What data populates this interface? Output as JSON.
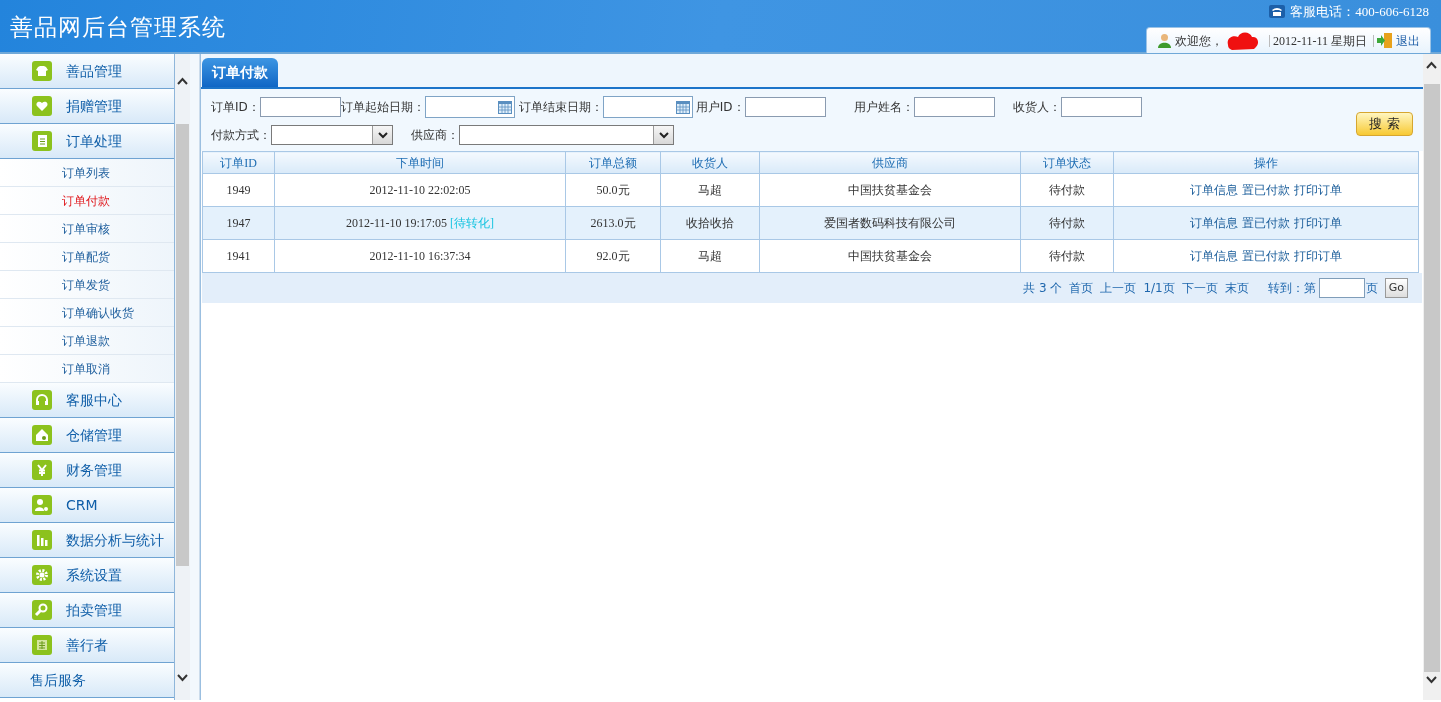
{
  "header": {
    "title": "善品网后台管理系统",
    "hotline": "客服电话：400-606-6128",
    "welcome": "欢迎您，",
    "date": "2012-11-11 星期日",
    "logout": "退出"
  },
  "sidebar": {
    "items": [
      {
        "label": "善品管理"
      },
      {
        "label": "捐赠管理"
      },
      {
        "label": "订单处理",
        "children": [
          {
            "label": "订单列表",
            "selected": false
          },
          {
            "label": "订单付款",
            "selected": true
          },
          {
            "label": "订单审核",
            "selected": false
          },
          {
            "label": "订单配货",
            "selected": false
          },
          {
            "label": "订单发货",
            "selected": false
          },
          {
            "label": "订单确认收货",
            "selected": false
          },
          {
            "label": "订单退款",
            "selected": false
          },
          {
            "label": "订单取消",
            "selected": false
          }
        ]
      },
      {
        "label": "客服中心"
      },
      {
        "label": "仓储管理"
      },
      {
        "label": "财务管理"
      },
      {
        "label": "CRM"
      },
      {
        "label": "数据分析与统计"
      },
      {
        "label": "系统设置"
      },
      {
        "label": "拍卖管理"
      },
      {
        "label": "善行者"
      },
      {
        "label": "售后服务"
      }
    ]
  },
  "panel": {
    "tab": "订单付款",
    "filters": [
      {
        "kind": "text",
        "label": "订单ID："
      },
      {
        "kind": "date",
        "label": "订单起始日期："
      },
      {
        "kind": "date",
        "label": "订单结束日期："
      },
      {
        "kind": "text",
        "label": "用户ID："
      },
      {
        "kind": "text",
        "label": "用户姓名："
      },
      {
        "kind": "text",
        "label": "收货人："
      },
      {
        "kind": "select",
        "label": "付款方式："
      },
      {
        "kind": "select",
        "label": "供应商："
      }
    ],
    "search_button": "搜 索",
    "table": {
      "columns": [
        "订单ID",
        "下单时间",
        "订单总额",
        "收货人",
        "供应商",
        "订单状态",
        "操作"
      ],
      "rows": [
        {
          "highlighted": false,
          "cells": [
            "1949",
            "2012-11-10 22:02:05",
            "50.0元",
            "马超",
            "中国扶贫基金会",
            "待付款"
          ],
          "actions": [
            "订单信息",
            "置已付款",
            "打印订单"
          ]
        },
        {
          "highlighted": true,
          "cells": [
            "1947",
            "2012-11-10 19:17:05",
            "2613.0元",
            "收拾收拾",
            "爱国者数码科技有限公司",
            "待付款"
          ],
          "tag": "[待转化]",
          "actions": [
            "订单信息",
            "置已付款",
            "打印订单"
          ]
        },
        {
          "highlighted": false,
          "cells": [
            "1941",
            "2012-11-10 16:37:34",
            "92.0元",
            "马超",
            "中国扶贫基金会",
            "待付款"
          ],
          "actions": [
            "订单信息",
            "置已付款",
            "打印订单"
          ]
        }
      ]
    },
    "pagination": {
      "total": "共 3 个",
      "links": [
        "首页",
        "上一页",
        "1/1页",
        "下一页",
        "末页"
      ],
      "goto_label": "转到：第",
      "goto_suffix": "页",
      "go_button": "Go"
    }
  }
}
